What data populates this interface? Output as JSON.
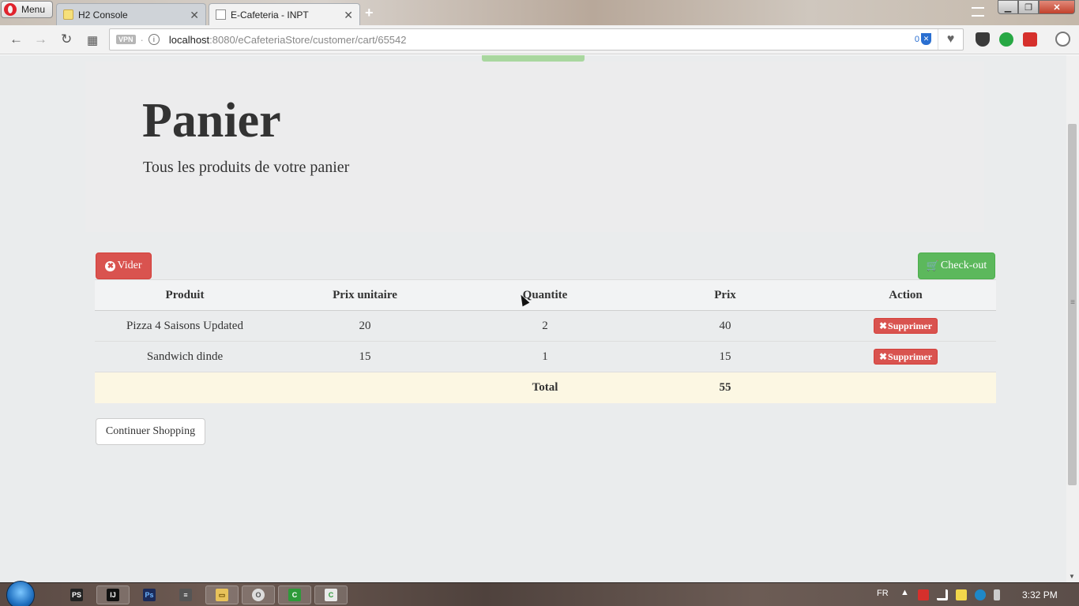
{
  "browser": {
    "menu_label": "Menu",
    "tabs": [
      {
        "title": "H2 Console",
        "close": "✕"
      },
      {
        "title": "E-Cafeteria - INPT",
        "close": "✕"
      }
    ],
    "new_tab": "+",
    "window_buttons": {
      "minimize": "▁",
      "maximize": "❐",
      "close": "✕"
    },
    "address": {
      "vpn": "VPN",
      "dot": "·",
      "info_icon": "i",
      "host": "localhost",
      "path": ":8080/eCafeteriaStore/customer/cart/65542",
      "adblock_count": "0"
    },
    "nav_icons": {
      "back": "←",
      "forward": "→",
      "reload": "↻",
      "speed_dial": "▦",
      "heart": "♥"
    }
  },
  "page": {
    "title": "Panier",
    "subtitle": "Tous les produits de votre panier",
    "clear_button": {
      "icon": "✖",
      "label": "Vider"
    },
    "checkout_button": {
      "icon": "🛒",
      "label": "Check-out"
    },
    "table": {
      "headers": [
        "Produit",
        "Prix unitaire",
        "Quantite",
        "Prix",
        "Action"
      ],
      "rows": [
        {
          "product": "Pizza 4 Saisons Updated",
          "unit_price": "20",
          "quantity": "2",
          "price": "40",
          "action": "Supprimer"
        },
        {
          "product": "Sandwich dinde",
          "unit_price": "15",
          "quantity": "1",
          "price": "15",
          "action": "Supprimer"
        }
      ],
      "total_label": "Total",
      "total_value": "55"
    },
    "continue_button": "Continuer Shopping",
    "colors": {
      "danger": "#d9534f",
      "success": "#5cb85c",
      "warning_row": "#fcf7e3",
      "background": "#eaeced"
    }
  },
  "taskbar": {
    "apps": [
      "PS",
      "IJ",
      "Ps",
      "≡",
      "▭",
      "O",
      "C",
      "C"
    ],
    "language": "FR",
    "tray_up": "▲",
    "clock": "3:32 PM"
  }
}
